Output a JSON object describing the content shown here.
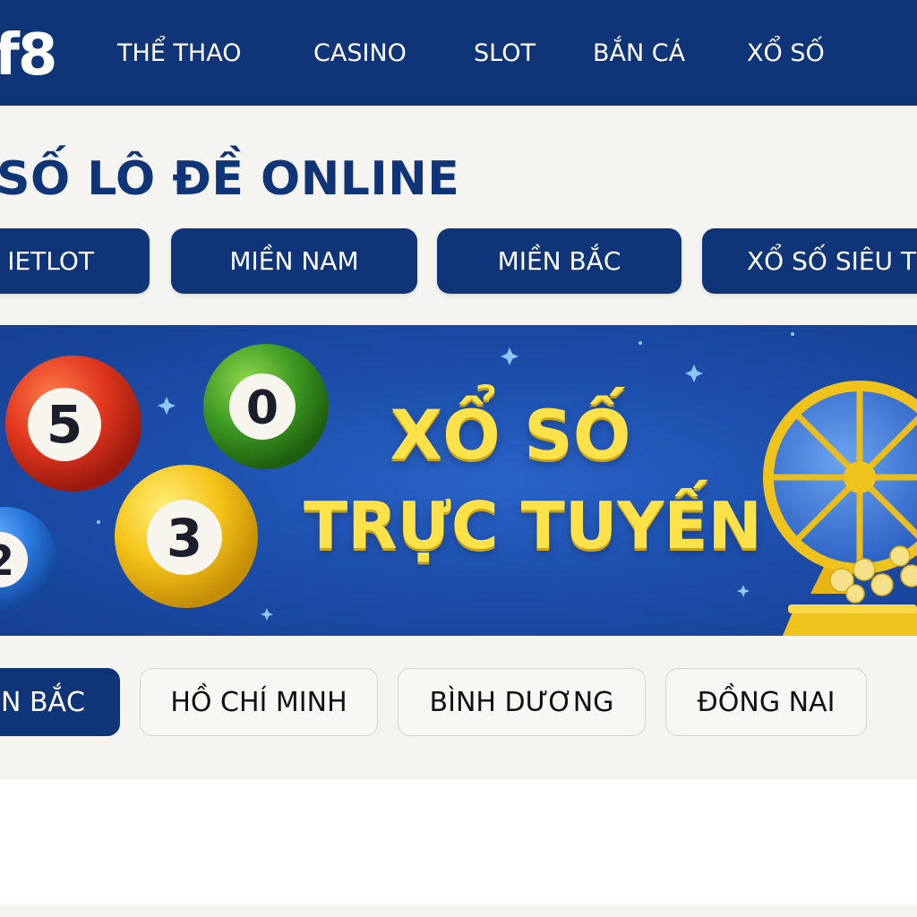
{
  "header": {
    "logo_text": "f8",
    "nav": [
      "THỂ THAO",
      "CASINO",
      "SLOT",
      "BẮN CÁ",
      "XỔ SỐ"
    ]
  },
  "page": {
    "title": "SỐ LÔ ĐỀ ONLINE"
  },
  "categories": [
    "IETLOT",
    "MIỀN NAM",
    "MIỀN BẮC",
    "XỔ SỐ SIÊU T"
  ],
  "banner": {
    "line1": "XỔ SỐ",
    "line2": "TRỰC TUYẾN",
    "balls": [
      {
        "number": "5",
        "color": "red"
      },
      {
        "number": "0",
        "color": "green"
      },
      {
        "number": "3",
        "color": "yellow"
      },
      {
        "number": "2",
        "color": "blue"
      }
    ]
  },
  "provinces": [
    {
      "label": "N BẮC",
      "active": true
    },
    {
      "label": "HỒ CHÍ MINH",
      "active": false
    },
    {
      "label": "BÌNH DƯƠNG",
      "active": false
    },
    {
      "label": "ĐỒNG NAI",
      "active": false
    }
  ],
  "colors": {
    "primary_navy": "#0f3478",
    "banner_blue": "#1d4fad",
    "banner_text_yellow": "#ffe14a",
    "background": "#f5f4f0"
  }
}
